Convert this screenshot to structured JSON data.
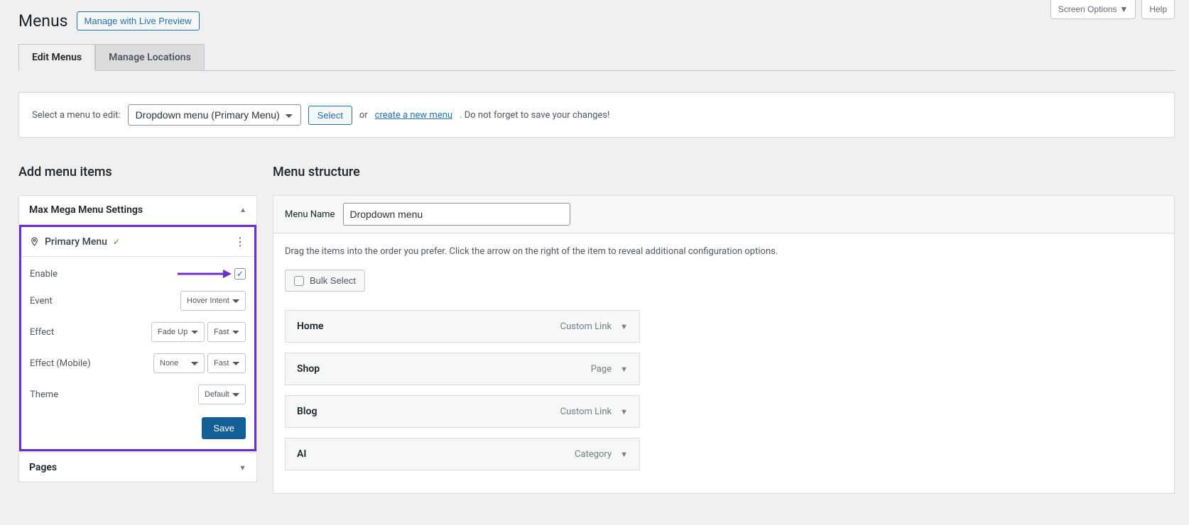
{
  "header": {
    "title": "Menus",
    "live_preview": "Manage with Live Preview",
    "screen_options": "Screen Options",
    "help": "Help"
  },
  "tabs": {
    "edit": "Edit Menus",
    "locations": "Manage Locations"
  },
  "selector": {
    "label": "Select a menu to edit:",
    "selected": "Dropdown menu (Primary Menu)",
    "select_btn": "Select",
    "or": "or ",
    "create_link": "create a new menu",
    "note": ". Do not forget to save your changes!"
  },
  "left": {
    "heading": "Add menu items",
    "accordion": {
      "title": "Max Mega Menu Settings",
      "location_label": "Primary Menu",
      "rows": {
        "enable": "Enable",
        "event": "Event",
        "event_val": "Hover Intent",
        "effect": "Effect",
        "effect_val": "Fade Up",
        "effect_speed": "Fast",
        "effect_mobile": "Effect (Mobile)",
        "effect_mobile_val": "None",
        "effect_mobile_speed": "Fast",
        "theme": "Theme",
        "theme_val": "Default"
      },
      "save": "Save"
    },
    "pages_accordion": "Pages"
  },
  "right": {
    "heading": "Menu structure",
    "menu_name_label": "Menu Name",
    "menu_name_value": "Dropdown menu",
    "hint": "Drag the items into the order you prefer. Click the arrow on the right of the item to reveal additional configuration options.",
    "bulk_select": "Bulk Select",
    "items": [
      {
        "title": "Home",
        "type": "Custom Link"
      },
      {
        "title": "Shop",
        "type": "Page"
      },
      {
        "title": "Blog",
        "type": "Custom Link"
      },
      {
        "title": "AI",
        "type": "Category"
      }
    ]
  }
}
